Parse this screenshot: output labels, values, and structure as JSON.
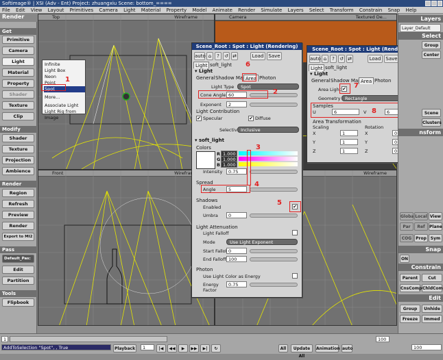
{
  "titlebar": {
    "text": "Softimage® | XSI (Adv - Ent) Project: zhuangxiu    Scene: bottom_===="
  },
  "menubar": [
    "File",
    "Edit",
    "View",
    "Layout",
    "Primitives",
    "Camera",
    "Light",
    "Material",
    "Property",
    "Model",
    "Animate",
    "Render",
    "Simulate",
    "Layers",
    "Select",
    "Transform",
    "Constrain",
    "Snap",
    "Help"
  ],
  "left": {
    "header": "Render",
    "get": "Get",
    "buttons_get": [
      "Primitive",
      "Camera",
      "Light",
      "Material",
      "Property",
      "Shader",
      "Texture",
      "Clip"
    ],
    "modify": "Modify",
    "buttons_modify": [
      "Shader",
      "Texture",
      "Projection",
      "Ambience"
    ],
    "render": "Render",
    "buttons_render": [
      "Region",
      "Refresh",
      "Preview",
      "Render",
      "Export to MI2"
    ],
    "pass": "Pass",
    "pass_value": "Default_Pas:",
    "buttons_pass": [
      "Edit",
      "Partition"
    ],
    "tools": "Tools",
    "buttons_tools": [
      "Flipbook"
    ]
  },
  "context_menu": {
    "items": [
      "Infinite",
      "Light Box",
      "Neon",
      "Point",
      "Spot",
      "More...",
      "Associate Light",
      "Light Rig from Image"
    ],
    "selected": "Spot"
  },
  "viewports": {
    "top_left": {
      "name": "Top",
      "mode": "Wireframe"
    },
    "top_right": {
      "name": "Camera",
      "mode": "Textured De..."
    },
    "bottom_left": {
      "name": "Front",
      "mode": "Wireframe"
    },
    "bottom_right": {
      "name": "",
      "mode": "Wireframe"
    }
  },
  "ppg1": {
    "title": "Scene_Root : Spot : Light (Rendering)",
    "auto": "auto",
    "load": "Load",
    "save": "Save",
    "tabs_top": [
      "Light",
      "soft_light"
    ],
    "section_light": "Light",
    "tabs": [
      "General",
      "Shadow Map",
      "Area",
      "Photon"
    ],
    "light_type_label": "Light Type",
    "light_type": "Spot",
    "cone_angle_label": "Cone Angle",
    "cone_angle": "60",
    "exponent_label": "Exponent",
    "exponent": "2",
    "light_contribution": "Light Contribution",
    "specular": "Specular",
    "diffuse": "Diffuse",
    "selective_light_label": "Selective Light",
    "selective_light": "Inclusive",
    "section_soft": "soft_light",
    "colors": "Colors",
    "r_label": "R",
    "r": "1.000",
    "g_label": "G",
    "g": "1.000",
    "b_label": "B",
    "b": "1.000",
    "intensity_label": "Intensity",
    "intensity": "0.75",
    "spread": "Spread",
    "angle_label": "Angle",
    "angle": "5",
    "shadows": "Shadows",
    "enabled": "Enabled",
    "umbra_label": "Umbra",
    "umbra": "0",
    "light_attenuation": "Light Attenuation",
    "light_falloff": "Light Falloff",
    "mode_label": "Mode",
    "mode": "Use Light Exponent",
    "start_falloff_label": "Start Falloff",
    "start_falloff": "0",
    "end_falloff_label": "End Falloff",
    "end_falloff": "100",
    "photon": "Photon",
    "use_light_color": "Use Light Color as Energy",
    "energy_label": "Energy Factor",
    "energy": "0.75"
  },
  "ppg2": {
    "title": "Scene_Root : Spot : Light (Rendering)",
    "auto": "auto",
    "load": "Load",
    "save": "Save",
    "tabs_top": [
      "Light",
      "soft_light"
    ],
    "section_light": "Light",
    "tabs": [
      "General",
      "Shadow Map",
      "Area",
      "Photon"
    ],
    "area_light": "Area Light",
    "geometry_label": "Geometry",
    "geometry": "Rectangle",
    "samples": "Samples",
    "u_label": "U",
    "u": "6",
    "v_label": "V",
    "v": "6",
    "area_transformation": "Area Transformation",
    "scaling": "Scaling",
    "rotation": "Rotation",
    "sx": "1",
    "sy": "1",
    "sz": "1",
    "rx": "0",
    "ry": "0",
    "rz": "0",
    "x": "X",
    "y": "Y",
    "z": "Z"
  },
  "annotations": [
    "1",
    "2",
    "3",
    "4",
    "5",
    "6",
    "7",
    "8"
  ],
  "right": {
    "layers": "Layers",
    "layer_default": "Layer_Default",
    "select": "Select",
    "group": "Group",
    "center": "Center",
    "scene": "Scene",
    "clusters": "Clusters",
    "transform": "nsform",
    "global": "Global",
    "local": "Local",
    "view": "View",
    "par": "Par",
    "ref": "Ref",
    "plane": "Plane",
    "cog": "COG",
    "prop": "Prop",
    "sym": "Sym",
    "snap": "Snap",
    "on": "ON",
    "constrain": "Constrain",
    "parent": "Parent",
    "cut": "Cut",
    "cnscomp": "CnsComp",
    "chldcomp": "ChldComp",
    "edit": "Edit",
    "group2": "Group",
    "unhide": "Unhide",
    "freeze": "Freeze",
    "immed": "Immed"
  },
  "bottom": {
    "frame_start": "1",
    "frame_end": "100",
    "current": "1",
    "playback": "Playback",
    "all": "All",
    "update_all": "Update All",
    "animation": "Animation",
    "auto": "auto",
    "frame100": "100",
    "command": "AddToSelection \"Spot\", , True"
  },
  "colors": {
    "accent": "#1f3c7a",
    "annotation": "#e02020",
    "wire": "#e6e600"
  }
}
